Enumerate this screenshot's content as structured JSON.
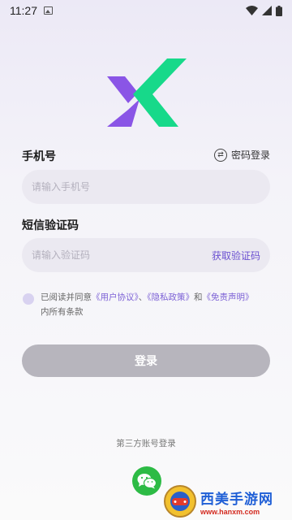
{
  "status_bar": {
    "time": "11:27"
  },
  "login": {
    "phone_label": "手机号",
    "switch_mode_label": "密码登录",
    "phone_placeholder": "请输入手机号",
    "code_label": "短信验证码",
    "code_placeholder": "请输入验证码",
    "get_code_label": "获取验证码",
    "agreement": {
      "prefix": "已阅读并同意",
      "user_agreement": "《用户协议》",
      "sep1": "、",
      "privacy_policy": "《隐私政策》",
      "and": "和",
      "disclaimer": "《免责声明》",
      "suffix": "内所有条款"
    },
    "login_button": "登录",
    "third_party_label": "第三方账号登录"
  },
  "watermark": {
    "title": "西美手游网",
    "url": "www.hanxm.com"
  },
  "colors": {
    "accent_purple": "#7d62d6",
    "logo_green": "#17d98a",
    "logo_purple": "#8a55e6",
    "wechat_green": "#2dbb45",
    "button_disabled": "#b7b5bd"
  },
  "icons": {
    "status_image": "image-icon",
    "wifi": "wifi-icon",
    "signal": "signal-icon",
    "battery": "battery-icon",
    "switch": "swap-icon",
    "wechat": "wechat-icon"
  }
}
